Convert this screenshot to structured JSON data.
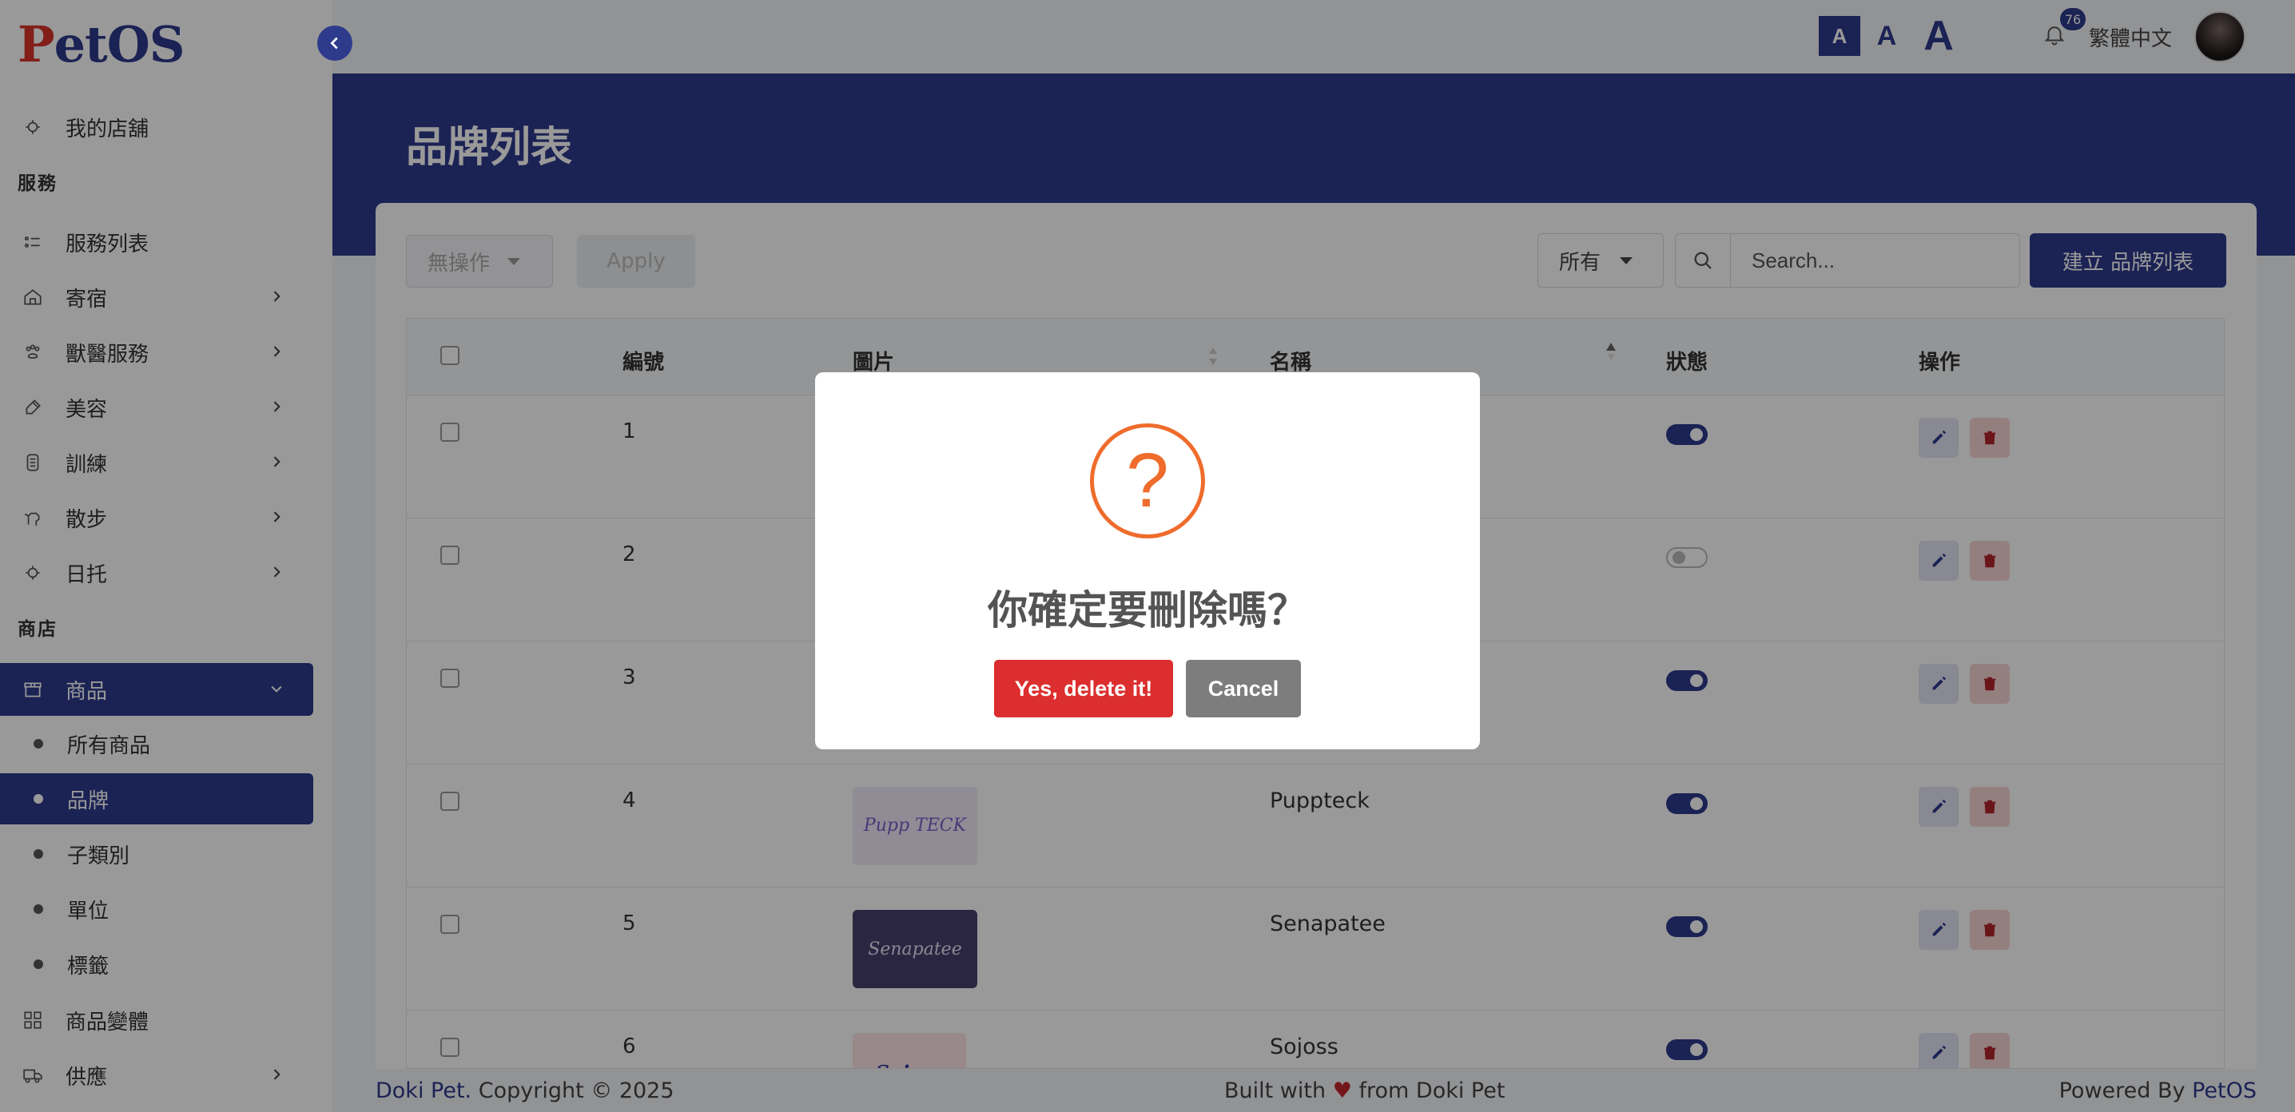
{
  "app": {
    "logo_text_p": "P",
    "logo_text_rest": "etOS"
  },
  "topbar": {
    "font_small": "A",
    "font_medium": "A",
    "font_large": "A",
    "notification_count": "76",
    "language": "繁體中文"
  },
  "sidebar": {
    "my_store": "我的店舖",
    "section_services": "服務",
    "service_list": "服務列表",
    "boarding": "寄宿",
    "vet": "獸醫服務",
    "grooming": "美容",
    "training": "訓練",
    "walking": "散步",
    "daycare": "日托",
    "section_shop": "商店",
    "products": "商品",
    "sub": {
      "all_products": "所有商品",
      "brands": "品牌",
      "subcategories": "子類別",
      "units": "單位",
      "tags": "標籤"
    },
    "variants": "商品變體",
    "supply": "供應"
  },
  "page": {
    "title": "品牌列表"
  },
  "toolbar": {
    "bulk_action": "無操作",
    "apply": "Apply",
    "filter": "所有",
    "search_placeholder": "Search...",
    "create": "建立 品牌列表"
  },
  "table": {
    "headers": {
      "id": "編號",
      "image": "圖片",
      "name": "名稱",
      "status": "狀態",
      "actions": "操作"
    },
    "rows": [
      {
        "id": "1",
        "name": "",
        "image_text": "",
        "status": true
      },
      {
        "id": "2",
        "name": "",
        "image_text": "",
        "status": false
      },
      {
        "id": "3",
        "name": "",
        "image_text": "",
        "status": true
      },
      {
        "id": "4",
        "name": "Puppteck",
        "image_text": "Pupp TECK",
        "status": true
      },
      {
        "id": "5",
        "name": "Senapatee",
        "image_text": "Senapatee",
        "status": true
      },
      {
        "id": "6",
        "name": "Sojoss",
        "image_text": "Sojoss",
        "status": true
      }
    ]
  },
  "footer": {
    "brand": "Doki Pet.",
    "copyright": " Copyright © 2025",
    "built_prefix": "Built with ",
    "heart": "♥",
    "built_suffix": " from Doki Pet",
    "powered_prefix": "Powered By ",
    "powered_brand": "PetOS"
  },
  "modal": {
    "icon": "?",
    "title": "你確定要刪除嗎？",
    "confirm": "Yes, delete it!",
    "cancel": "Cancel"
  },
  "colors": {
    "primary": "#2e3a8c",
    "danger": "#dc2e2e",
    "warning": "#ef6c2c",
    "neutral": "#7d7d7d"
  }
}
